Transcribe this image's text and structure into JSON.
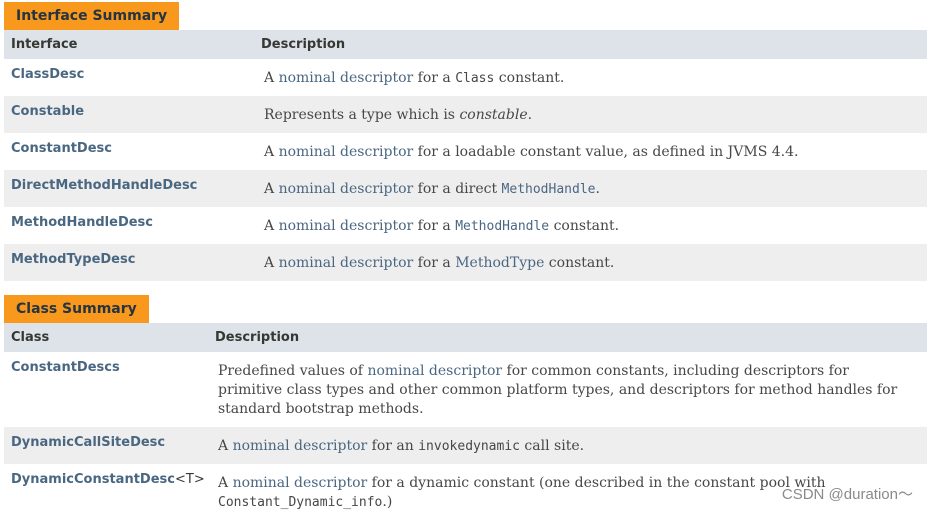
{
  "interface_summary": {
    "tab_label": "Interface Summary",
    "headers": [
      "Interface",
      "Description"
    ],
    "rows": [
      {
        "name": "ClassDesc",
        "desc": [
          {
            "t": "A "
          },
          {
            "t": "nominal descriptor",
            "link": true
          },
          {
            "t": " for a "
          },
          {
            "t": "Class",
            "code": true
          },
          {
            "t": " constant."
          }
        ]
      },
      {
        "name": "Constable",
        "desc": [
          {
            "t": "Represents a type which is "
          },
          {
            "t": "constable",
            "em": true
          },
          {
            "t": "."
          }
        ]
      },
      {
        "name": "ConstantDesc",
        "desc": [
          {
            "t": "A "
          },
          {
            "t": "nominal descriptor",
            "link": true
          },
          {
            "t": " for a loadable constant value, as defined in JVMS 4.4."
          }
        ]
      },
      {
        "name": "DirectMethodHandleDesc",
        "desc": [
          {
            "t": "A "
          },
          {
            "t": "nominal descriptor",
            "link": true
          },
          {
            "t": " for a direct "
          },
          {
            "t": "MethodHandle",
            "code": true,
            "link": true
          },
          {
            "t": "."
          }
        ]
      },
      {
        "name": "MethodHandleDesc",
        "desc": [
          {
            "t": "A "
          },
          {
            "t": "nominal descriptor",
            "link": true
          },
          {
            "t": " for a "
          },
          {
            "t": "MethodHandle",
            "code": true,
            "link": true
          },
          {
            "t": " constant."
          }
        ]
      },
      {
        "name": "MethodTypeDesc",
        "desc": [
          {
            "t": "A "
          },
          {
            "t": "nominal descriptor",
            "link": true
          },
          {
            "t": " for a "
          },
          {
            "t": "MethodType",
            "link": true
          },
          {
            "t": " constant."
          }
        ]
      }
    ]
  },
  "class_summary": {
    "tab_label": "Class Summary",
    "headers": [
      "Class",
      "Description"
    ],
    "rows": [
      {
        "name": "ConstantDescs",
        "type_param": "",
        "desc": [
          {
            "t": "Predefined values of "
          },
          {
            "t": "nominal descriptor",
            "link": true
          },
          {
            "t": " for common constants, including descriptors for primitive class types and other common platform types, and descriptors for method handles for standard bootstrap methods."
          }
        ]
      },
      {
        "name": "DynamicCallSiteDesc",
        "type_param": "",
        "desc": [
          {
            "t": "A "
          },
          {
            "t": "nominal descriptor",
            "link": true
          },
          {
            "t": " for an "
          },
          {
            "t": "invokedynamic",
            "code": true
          },
          {
            "t": " call site."
          }
        ]
      },
      {
        "name": "DynamicConstantDesc",
        "type_param": "<T>",
        "desc": [
          {
            "t": "A "
          },
          {
            "t": "nominal descriptor",
            "link": true
          },
          {
            "t": " for a dynamic constant (one described in the constant pool with "
          },
          {
            "t": "Constant_Dynamic_info",
            "code": true
          },
          {
            "t": ".)"
          }
        ]
      }
    ]
  },
  "watermark": "CSDN @duration～"
}
